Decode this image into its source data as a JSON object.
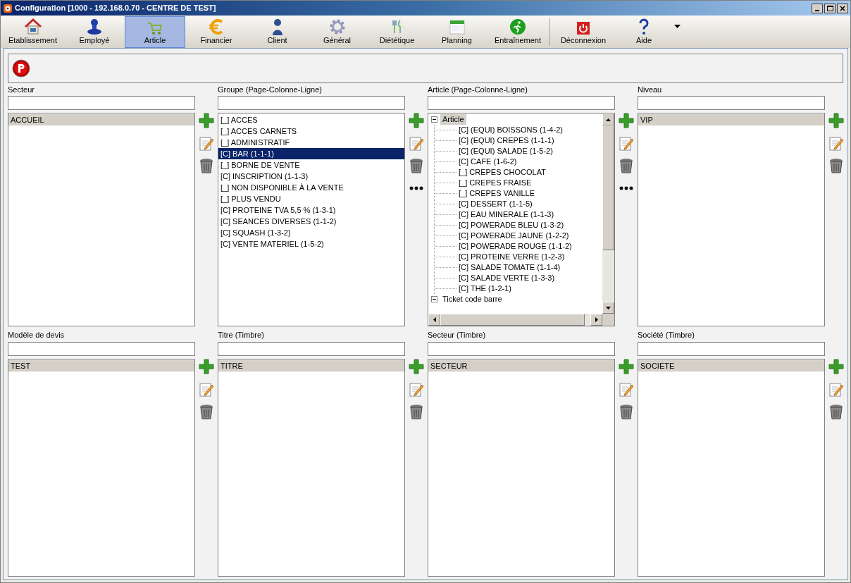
{
  "window": {
    "title": "Configuration [1000 - 192.168.0.70 - CENTRE DE TEST]"
  },
  "toolbar": {
    "groups": [
      [
        {
          "label": "Etablissement",
          "selected": false
        },
        {
          "label": "Employé",
          "selected": false
        },
        {
          "label": "Article",
          "selected": true
        },
        {
          "label": "Financier",
          "selected": false
        },
        {
          "label": "Client",
          "selected": false
        },
        {
          "label": "Général",
          "selected": false
        },
        {
          "label": "Diététique",
          "selected": false
        },
        {
          "label": "Planning",
          "selected": false
        },
        {
          "label": "Entraînement",
          "selected": false
        }
      ],
      [
        {
          "label": "Déconnexion",
          "selected": false
        },
        {
          "label": "Aide",
          "selected": false
        }
      ]
    ]
  },
  "panels": [
    {
      "label": "Secteur",
      "kind": "list",
      "focused": false,
      "more_button": false,
      "items": [
        {
          "text": "ACCUEIL",
          "selected": true
        }
      ]
    },
    {
      "label": "Groupe (Page-Colonne-Ligne)",
      "kind": "list",
      "focused": true,
      "more_button": true,
      "items": [
        {
          "text": "[_] ACCES",
          "selected": false
        },
        {
          "text": "[_] ACCES CARNETS",
          "selected": false
        },
        {
          "text": "[_] ADMINISTRATIF",
          "selected": false
        },
        {
          "text": "[C] BAR (1-1-1)",
          "selected": true
        },
        {
          "text": "[_] BORNE DE VENTE",
          "selected": false
        },
        {
          "text": "[C] INSCRIPTION (1-1-3)",
          "selected": false
        },
        {
          "text": "[_] NON DISPONIBLE À LA VENTE",
          "selected": false
        },
        {
          "text": "[_] PLUS VENDU",
          "selected": false
        },
        {
          "text": "[C] PROTEINE TVA 5,5 % (1-3-1)",
          "selected": false
        },
        {
          "text": "[C] SEANCES DIVERSES (1-1-2)",
          "selected": false
        },
        {
          "text": "[C] SQUASH (1-3-2)",
          "selected": false
        },
        {
          "text": "[C] VENTE MATERIEL (1-5-2)",
          "selected": false
        }
      ]
    },
    {
      "label": "Article (Page-Colonne-Ligne)",
      "kind": "tree",
      "focused": false,
      "more_button": true,
      "items": [
        {
          "text": "Article",
          "selected": true,
          "expanded": true,
          "children": [
            {
              "text": "[C] (EQUI) BOISSONS (1-4-2)",
              "selected": false
            },
            {
              "text": "[C] (EQUI) CREPES (1-1-1)",
              "selected": false
            },
            {
              "text": "[C] (EQUI) SALADE (1-5-2)",
              "selected": false
            },
            {
              "text": "[C] CAFE (1-6-2)",
              "selected": false
            },
            {
              "text": "[_] CREPES CHOCOLAT",
              "selected": false
            },
            {
              "text": "[_] CREPES FRAISE",
              "selected": false
            },
            {
              "text": "[_] CREPES VANILLE",
              "selected": false
            },
            {
              "text": "[C] DESSERT (1-1-5)",
              "selected": false
            },
            {
              "text": "[C] EAU MINERALE (1-1-3)",
              "selected": false
            },
            {
              "text": "[C] POWERADE BLEU (1-3-2)",
              "selected": false
            },
            {
              "text": "[C] POWERADE JAUNE (1-2-2)",
              "selected": false
            },
            {
              "text": "[C] POWERADE ROUGE (1-1-2)",
              "selected": false
            },
            {
              "text": "[C] PROTEINE VERRE (1-2-3)",
              "selected": false
            },
            {
              "text": "[C] SALADE TOMATE (1-1-4)",
              "selected": false
            },
            {
              "text": "[C] SALADE VERTE (1-3-3)",
              "selected": false
            },
            {
              "text": "[C] THE (1-2-1)",
              "selected": false
            }
          ]
        },
        {
          "text": "Ticket code barre",
          "selected": false,
          "expanded": true
        }
      ]
    },
    {
      "label": "Niveau",
      "kind": "list",
      "focused": false,
      "more_button": false,
      "items": [
        {
          "text": "VIP",
          "selected": true
        }
      ]
    },
    {
      "label": "Modèle de devis",
      "kind": "list",
      "focused": false,
      "more_button": false,
      "items": [
        {
          "text": "TEST",
          "selected": true
        }
      ]
    },
    {
      "label": "Titre (Timbre)",
      "kind": "list",
      "focused": false,
      "more_button": false,
      "items": [
        {
          "text": "TITRE",
          "selected": true
        }
      ]
    },
    {
      "label": "Secteur (Timbre)",
      "kind": "list",
      "focused": false,
      "more_button": false,
      "items": [
        {
          "text": "SECTEUR",
          "selected": true
        }
      ]
    },
    {
      "label": "Société (Timbre)",
      "kind": "list",
      "focused": false,
      "more_button": false,
      "items": [
        {
          "text": "SOCIETE",
          "selected": true
        }
      ]
    }
  ]
}
